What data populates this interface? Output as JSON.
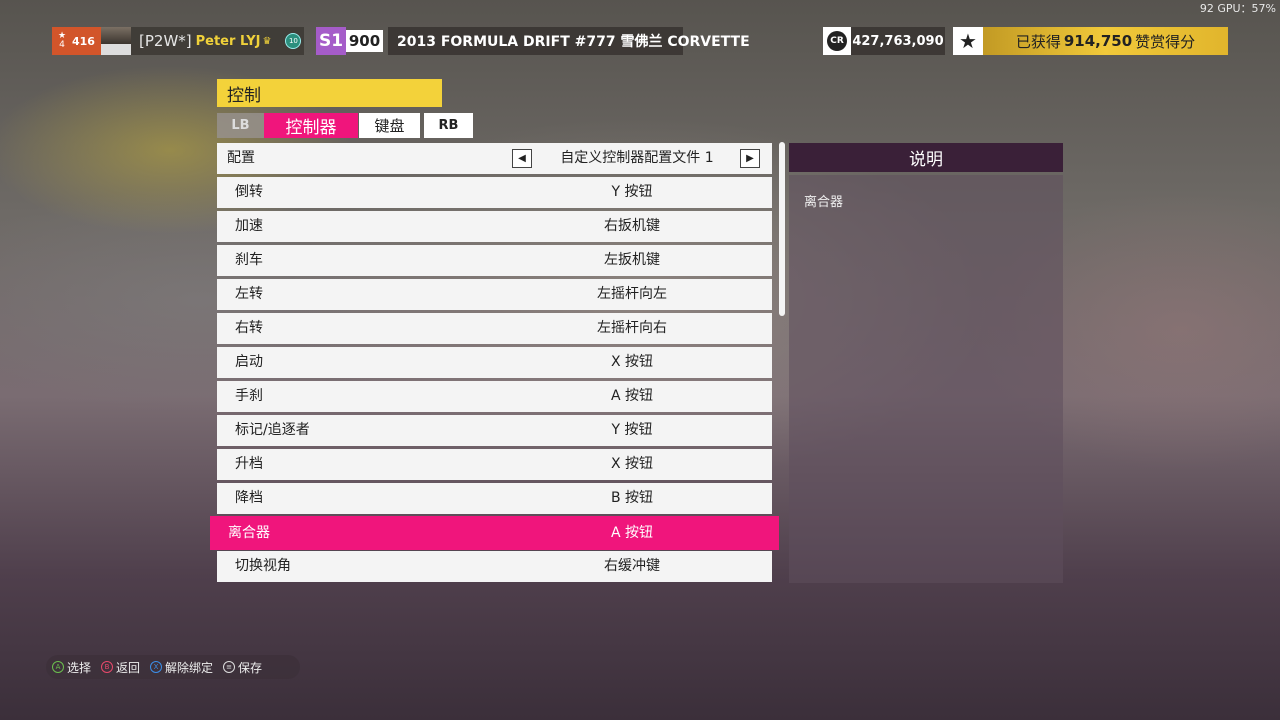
{
  "overlay": {
    "gpu": "92 GPU：57%"
  },
  "header": {
    "level": "416",
    "level_sub": "4",
    "player_tag": "[P2W*]",
    "player_name": "Peter LYJ",
    "rank_badge": "10",
    "car_class": "S1",
    "car_pi": "900",
    "car_name": "2013 FORMULA DRIFT #777 雪佛兰 CORVETTE",
    "credits_icon": "CR",
    "credits": "427,763,090",
    "skill_prefix": "已获得",
    "skill_points": "914,750",
    "skill_suffix": "赞赏得分"
  },
  "panel": {
    "title": "控制",
    "tabs": {
      "lb": "LB",
      "controller": "控制器",
      "keyboard": "键盘",
      "rb": "RB"
    },
    "config": {
      "label": "配置",
      "value": "自定义控制器配置文件 1"
    },
    "rows": [
      {
        "label": "倒转",
        "value": "Y 按钮"
      },
      {
        "label": "加速",
        "value": "右扳机键"
      },
      {
        "label": "刹车",
        "value": "左扳机键"
      },
      {
        "label": "左转",
        "value": "左摇杆向左"
      },
      {
        "label": "右转",
        "value": "左摇杆向右"
      },
      {
        "label": "启动",
        "value": "X 按钮"
      },
      {
        "label": "手刹",
        "value": "A 按钮"
      },
      {
        "label": "标记/追逐者",
        "value": "Y 按钮"
      },
      {
        "label": "升档",
        "value": "X 按钮"
      },
      {
        "label": "降档",
        "value": "B 按钮"
      },
      {
        "label": "离合器",
        "value": "A 按钮",
        "selected": true
      },
      {
        "label": "切换视角",
        "value": "右缓冲键"
      }
    ]
  },
  "description": {
    "title": "说明",
    "text": "离合器"
  },
  "footer": {
    "select": {
      "key": "A",
      "label": "选择",
      "color": "#6bbf4e"
    },
    "back": {
      "key": "B",
      "label": "返回",
      "color": "#e8496b"
    },
    "unbind": {
      "key": "X",
      "label": "解除绑定",
      "color": "#3c8ee8"
    },
    "save": {
      "key": "≡",
      "label": "保存",
      "color": "#dddddd"
    }
  },
  "colors": {
    "accent": "#f0157c",
    "title_yellow": "#f3d23a",
    "class_purple": "#a55cc9"
  }
}
